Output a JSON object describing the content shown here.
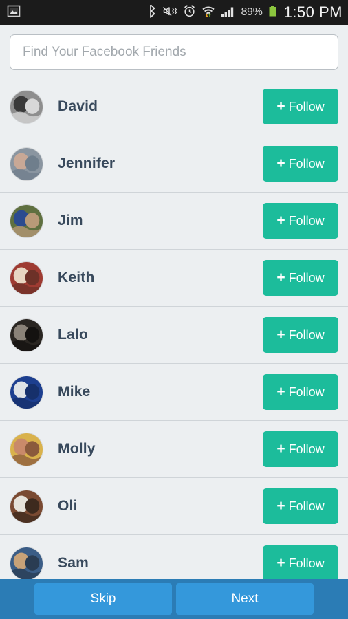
{
  "statusbar": {
    "notification_icon": "image-icon",
    "icons": [
      "bluetooth-icon",
      "vibrate-mute-icon",
      "alarm-icon",
      "wifi-icon",
      "signal-icon"
    ],
    "battery_percent": "89%",
    "battery_color": "#8cc63e",
    "time": "1:50 PM"
  },
  "search": {
    "placeholder": "Find Your Facebook Friends",
    "value": ""
  },
  "theme": {
    "follow_green": "#1cbc9b",
    "nav_blue": "#3498db",
    "nav_bar_blue": "#2b7cb5",
    "name_color": "#38495c",
    "page_bg": "#eceff1"
  },
  "friends": [
    {
      "name": "David",
      "avatar": "couple-bw-photo",
      "follow_label": "Follow",
      "c1": "#8e8e8e",
      "c2": "#3a3a3a",
      "c3": "#d8d8d8"
    },
    {
      "name": "Jennifer",
      "avatar": "sunset-landscape-photo",
      "follow_label": "Follow",
      "c1": "#8a95a0",
      "c2": "#c8a896",
      "c3": "#6f7e8c"
    },
    {
      "name": "Jim",
      "avatar": "outdoor-child-photo",
      "follow_label": "Follow",
      "c1": "#5f7040",
      "c2": "#2b4b8f",
      "c3": "#b89a78"
    },
    {
      "name": "Keith",
      "avatar": "red-shirt-baby-photo",
      "follow_label": "Follow",
      "c1": "#9e3b32",
      "c2": "#e8d6c2",
      "c3": "#6d3128"
    },
    {
      "name": "Lalo",
      "avatar": "dark-indoor-photo",
      "follow_label": "Follow",
      "c1": "#2a2622",
      "c2": "#8a8278",
      "c3": "#141210"
    },
    {
      "name": "Mike",
      "avatar": "graduation-photo",
      "follow_label": "Follow",
      "c1": "#1d3f8f",
      "c2": "#dfe3e6",
      "c3": "#16306b"
    },
    {
      "name": "Molly",
      "avatar": "two-women-photo",
      "follow_label": "Follow",
      "c1": "#d9b24c",
      "c2": "#c98a6a",
      "c3": "#8a5a3c"
    },
    {
      "name": "Oli",
      "avatar": "backpack-man-photo",
      "follow_label": "Follow",
      "c1": "#7a4a32",
      "c2": "#e6e2da",
      "c3": "#3d2a1e"
    },
    {
      "name": "Sam",
      "avatar": "man-drink-photo",
      "follow_label": "Follow",
      "c1": "#3b5d86",
      "c2": "#c8a278",
      "c3": "#2a3c52"
    }
  ],
  "bottom": {
    "skip_label": "Skip",
    "next_label": "Next"
  }
}
